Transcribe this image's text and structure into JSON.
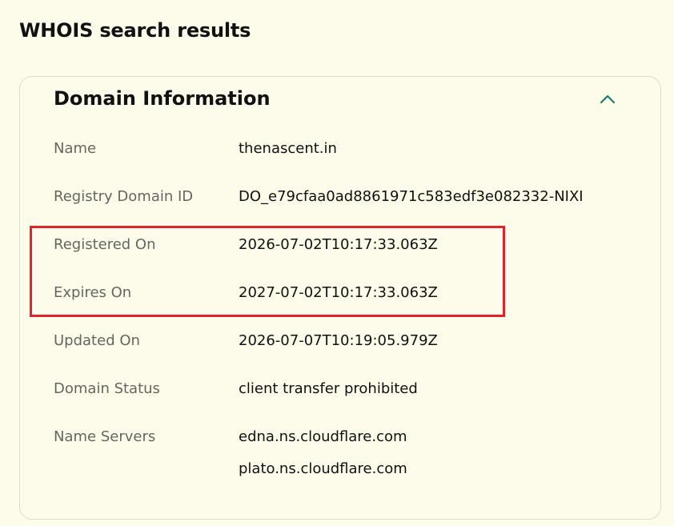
{
  "page": {
    "title": "WHOIS search results"
  },
  "domain_info": {
    "heading": "Domain Information",
    "toggle_icon": "chevron-up-icon",
    "accent_color": "#1a7a6d",
    "highlight_color": "#e0242c",
    "rows": [
      {
        "label": "Name",
        "value": "thenascent.in"
      },
      {
        "label": "Registry Domain ID",
        "value": "DO_e79cfaa0ad8861971c583edf3e082332-NIXI"
      },
      {
        "label": "Registered On",
        "value": "2026-07-02T10:17:33.063Z"
      },
      {
        "label": "Expires On",
        "value": "2027-07-02T10:17:33.063Z"
      },
      {
        "label": "Updated On",
        "value": "2026-07-07T10:19:05.979Z"
      },
      {
        "label": "Domain Status",
        "value": "client transfer prohibited"
      },
      {
        "label": "Name Servers",
        "values": [
          "edna.ns.cloudflare.com",
          "plato.ns.cloudflare.com"
        ]
      }
    ]
  }
}
